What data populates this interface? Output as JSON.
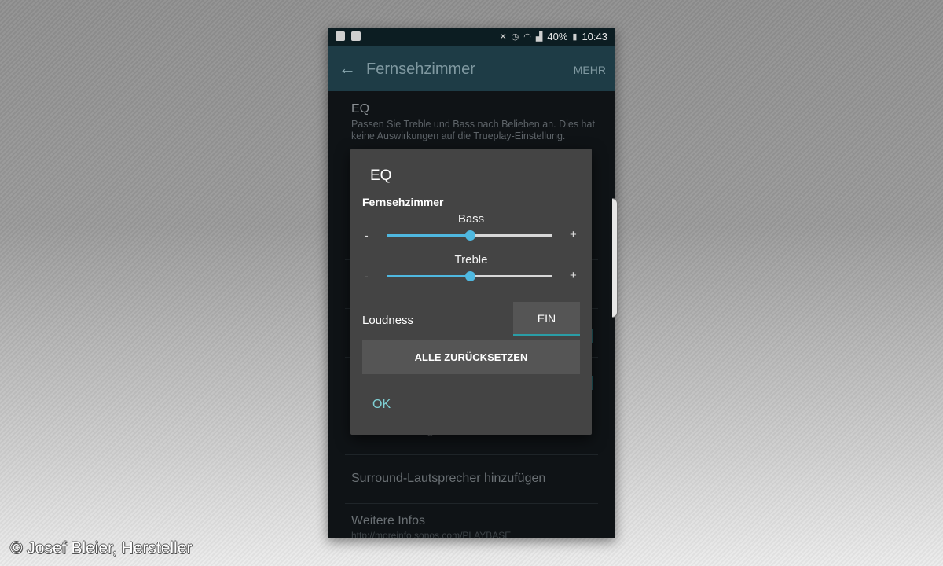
{
  "status_bar": {
    "battery": "40%",
    "time": "10:43"
  },
  "app_bar": {
    "back_icon": "back-arrow-icon",
    "title": "Fernsehzimmer",
    "more_label": "MEHR"
  },
  "list": {
    "eq_title": "EQ",
    "eq_description": "Passen Sie Treble und Bass nach Belieben an. Dies hat keine Auswirkungen auf die Trueplay-Einstellung.",
    "dimmed_fragment": "g",
    "surround_label": "Surround-Lautsprecher hinzufügen",
    "infos_title": "Weitere Infos",
    "infos_url": "http://moreinfo.sonos.com/PLAYBASE"
  },
  "dialog": {
    "title": "EQ",
    "room": "Fernsehzimmer",
    "bass": {
      "label": "Bass",
      "minus": "-",
      "plus": "+",
      "level": 0.5
    },
    "treble": {
      "label": "Treble",
      "minus": "-",
      "plus": "+",
      "level": 0.5
    },
    "loudness_label": "Loudness",
    "loudness_button": "EIN",
    "reset_button": "ALLE ZURÜCKSETZEN",
    "ok_button": "OK"
  },
  "credit": "© Josef Bleier, Hersteller",
  "colors": {
    "accent": "#4fb8e0",
    "teal": "#2a9da6",
    "app_bar": "#1e3c46",
    "dialog_bg": "#444444"
  }
}
